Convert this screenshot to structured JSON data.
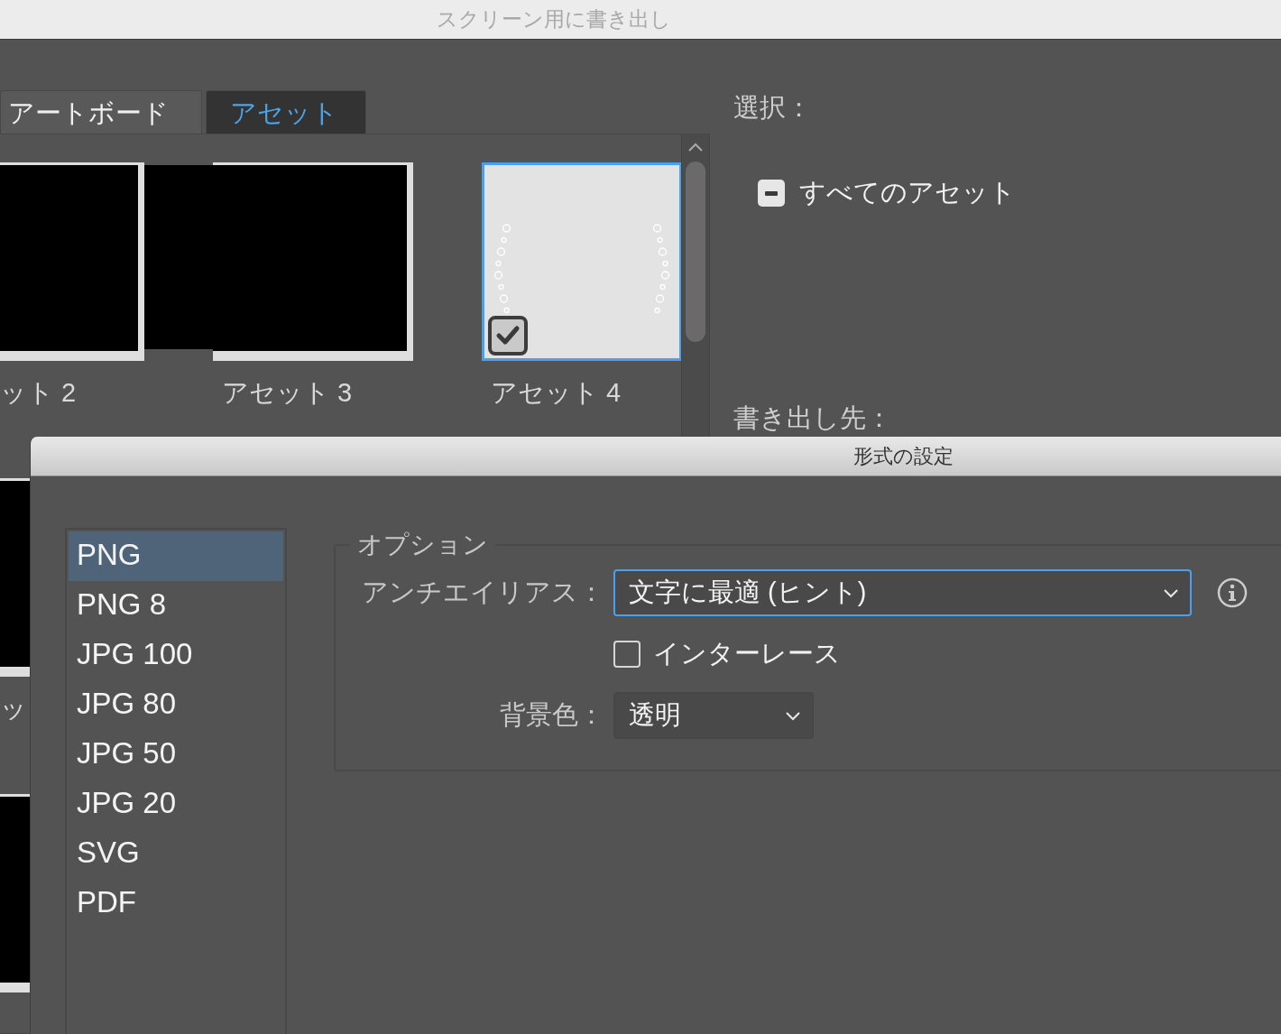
{
  "window": {
    "title": "スクリーン用に書き出し"
  },
  "tabs": [
    {
      "label": "アートボード",
      "selected": false
    },
    {
      "label": "アセット",
      "selected": true
    }
  ],
  "assets": [
    {
      "label": "ット 2",
      "kind": "dark",
      "selected": false
    },
    {
      "label": "アセット 3",
      "kind": "dark",
      "selected": false
    },
    {
      "label": "アセット 4",
      "kind": "wreath",
      "selected": true,
      "checked": true
    },
    {
      "label": "ッ",
      "kind": "dark"
    },
    {
      "kind": "dark"
    }
  ],
  "selection": {
    "heading": "選択：",
    "all_assets": {
      "label": "すべてのアセット",
      "mixed": true
    }
  },
  "export_to": {
    "heading": "書き出し先："
  },
  "format_dialog": {
    "title": "形式の設定",
    "formats": [
      {
        "label": "PNG",
        "selected": true
      },
      {
        "label": "PNG 8",
        "selected": false
      },
      {
        "label": "JPG 100",
        "selected": false
      },
      {
        "label": "JPG 80",
        "selected": false
      },
      {
        "label": "JPG 50",
        "selected": false
      },
      {
        "label": "JPG 20",
        "selected": false
      },
      {
        "label": "SVG",
        "selected": false
      },
      {
        "label": "PDF",
        "selected": false
      }
    ],
    "options": {
      "legend": "オプション",
      "antialias": {
        "label": "アンチエイリアス：",
        "value": "文字に最適 (ヒント)",
        "focused": true
      },
      "interlace": {
        "label": "インターレース",
        "checked": false
      },
      "background": {
        "label": "背景色：",
        "value": "透明",
        "focused": false
      }
    }
  }
}
